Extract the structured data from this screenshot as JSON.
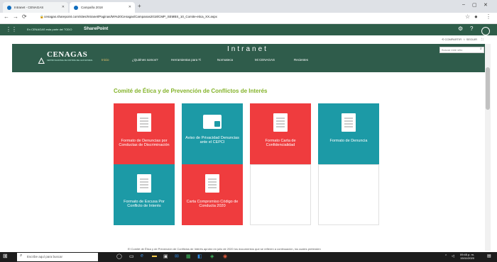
{
  "browser": {
    "tabs": [
      {
        "title": "Intranet - CENAGAS"
      },
      {
        "title": "Campaña 2018"
      }
    ],
    "new_tab": "+",
    "url": "cenagas.sharepoint.com/sites/Intranet/Paginas/MI%20Cenagas/Campanas2018/CMP_SEMBS_10_Comite-etica_XX.aspx",
    "window_controls": {
      "minimize": "–",
      "maximize": "▢",
      "close": "✕"
    }
  },
  "suitebar": {
    "tenant": "En CENAGAS esta parte del TODO",
    "app": "SharePoint"
  },
  "actions": {
    "share": "COMPARTIR",
    "follow": "SEGUIR"
  },
  "header": {
    "logo": "CENAGAS",
    "logo_sub": "CENTRO NACIONAL DE CONTROL DEL GAS NATURAL",
    "site_title": "Intranet",
    "search_placeholder": "Buscar este sitio",
    "nav": [
      "Inicio",
      "¿Quiénes somos?",
      "Herramientas para Ti",
      "Normateca",
      "Mi CENAGAS",
      "Recientes"
    ]
  },
  "page": {
    "title": "Comité de Ética y de Prevención de Conflictos de Interés",
    "tiles": [
      {
        "label": "Formato de Denuncias por Conductas de Discriminación",
        "color": "red",
        "icon": "document-icon"
      },
      {
        "label": "Aviso de Privacidad Denuncias ante el CEPCI",
        "color": "teal",
        "icon": "folder-lock-icon"
      },
      {
        "label": "Formato Carta de Confidencialidad",
        "color": "red",
        "icon": "document-icon"
      },
      {
        "label": "Formato de Denuncia",
        "color": "teal",
        "icon": "document-icon"
      },
      {
        "label": "Formato de Excusa Por Conflicto de Interés",
        "color": "teal",
        "icon": "document-icon"
      },
      {
        "label": "Carta Compromiso Código de Conducta 2020",
        "color": "red",
        "icon": "document-icon"
      }
    ],
    "bottom_text": "El Comité de Ética y de Prevención de Conflictos de Interés aprobó en julio de 2020 los documentos que se refieren a continuación, los cuales pretenden"
  },
  "taskbar": {
    "search_placeholder": "Escribe aquí para buscar",
    "time": "09:45 p. m.",
    "date": "15/11/2020"
  },
  "colors": {
    "green": "#2f5c4b",
    "accent": "#84b32a",
    "red": "#ef3c3e",
    "teal": "#1c9aa6"
  }
}
